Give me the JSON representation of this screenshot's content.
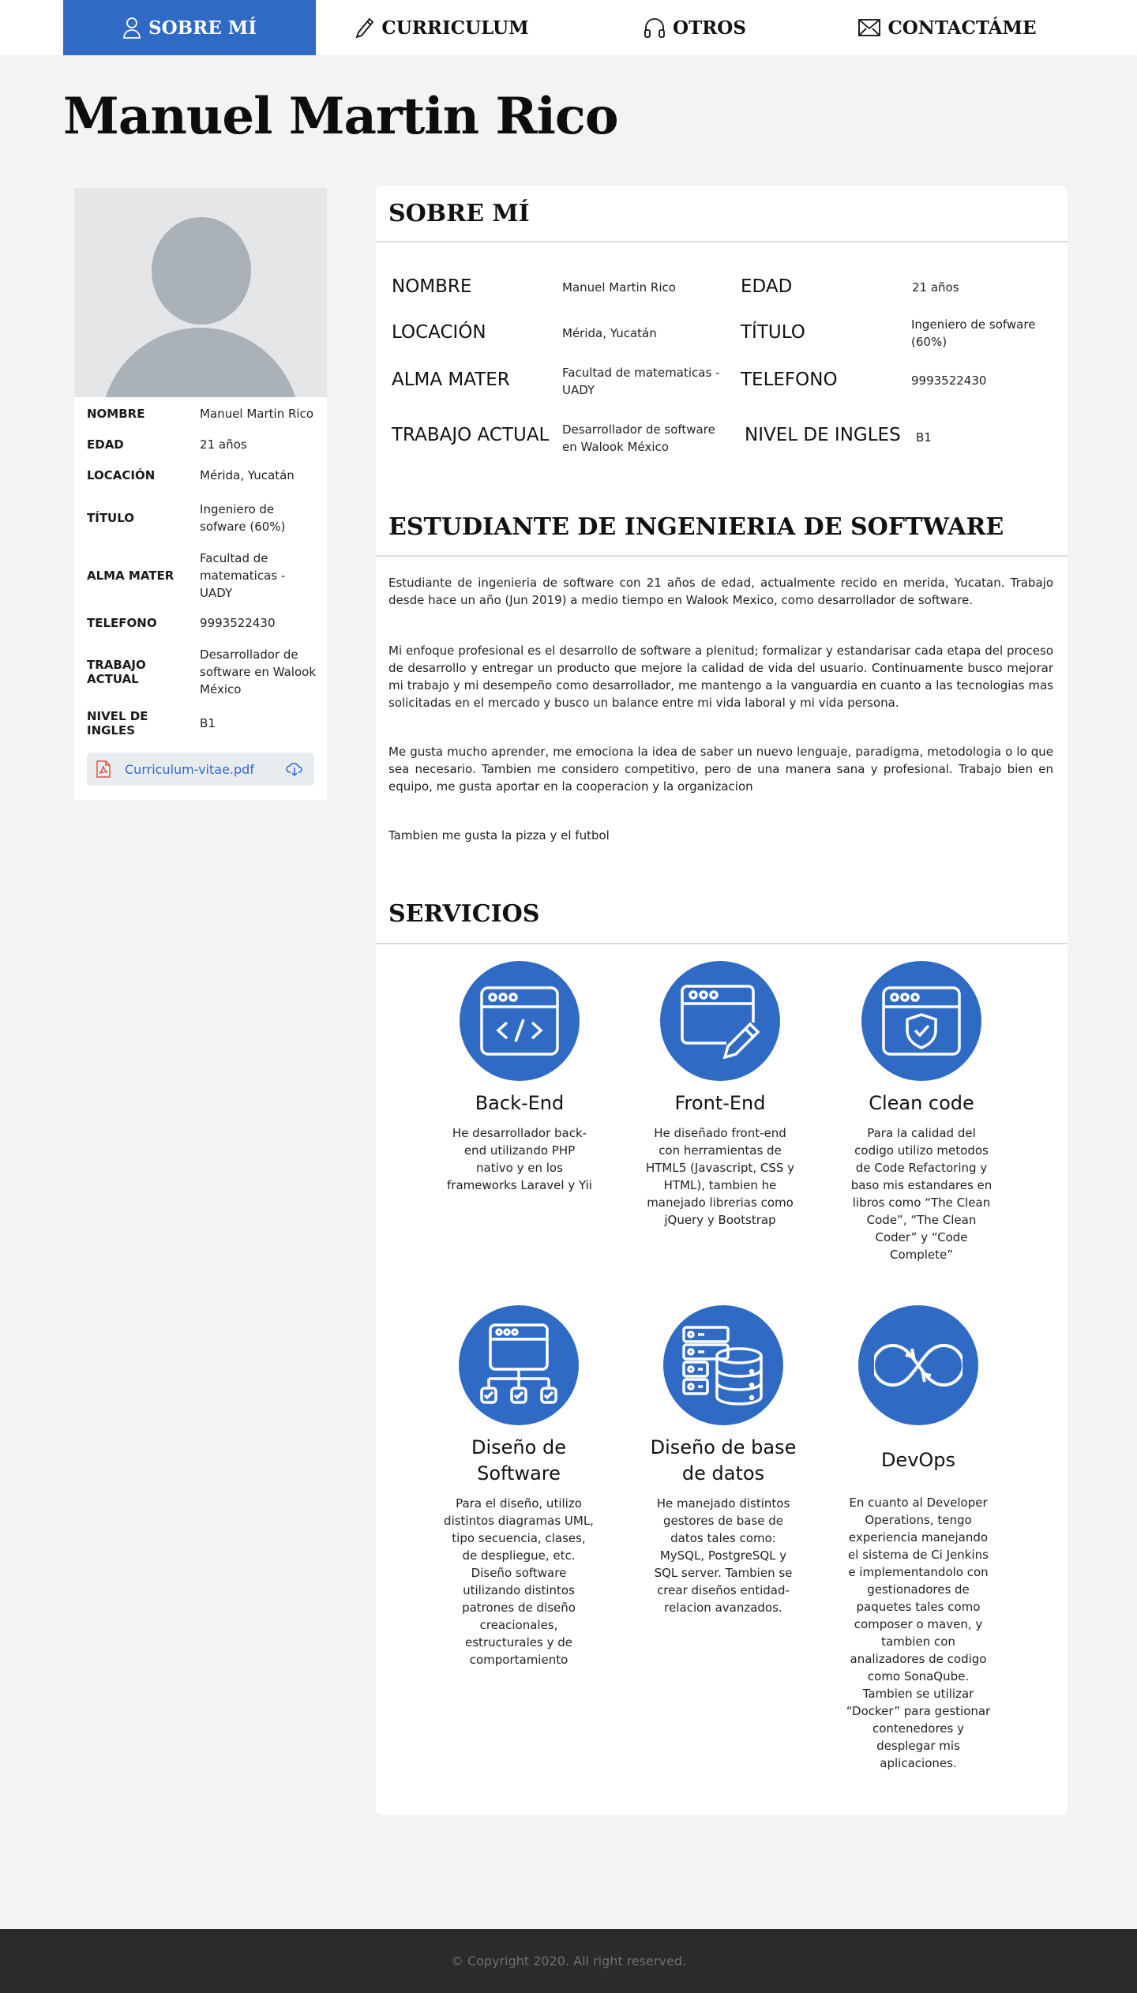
{
  "nav": {
    "items": [
      {
        "label": "SOBRE MÍ",
        "icon": "user-icon",
        "active": true
      },
      {
        "label": "CURRICULUM",
        "icon": "pencil-icon",
        "active": false
      },
      {
        "label": "OTROS",
        "icon": "headphones-icon",
        "active": false
      },
      {
        "label": "CONTACTÁME",
        "icon": "envelope-icon",
        "active": false
      }
    ]
  },
  "page_title": "Manuel Martin Rico",
  "sidebar": {
    "rows": [
      {
        "key": "NOMBRE",
        "value": "Manuel Martin Rico"
      },
      {
        "key": "EDAD",
        "value": "21 años"
      },
      {
        "key": "LOCACIÓN",
        "value": "Mérida, Yucatán"
      },
      {
        "key": "TÍTULO",
        "value": "Ingeniero de sofware (60%)"
      },
      {
        "key": "ALMA MATER",
        "value": "Facultad de matematicas - UADY"
      },
      {
        "key": "TELEFONO",
        "value": "9993522430"
      },
      {
        "key": "TRABAJO ACTUAL",
        "value": "Desarrollador de software en Walook México"
      },
      {
        "key": "NIVEL DE INGLES",
        "value": "B1"
      }
    ],
    "pdf": {
      "label": "Curriculum-vitae.pdf",
      "icon": "pdf-file-icon",
      "download_icon": "cloud-download-icon"
    }
  },
  "about": {
    "title": "SOBRE MÍ",
    "info": [
      {
        "key": "NOMBRE",
        "value": "Manuel Martin Rico"
      },
      {
        "key": "EDAD",
        "value": "21 años"
      },
      {
        "key": "LOCACIÓN",
        "value": "Mérida, Yucatán"
      },
      {
        "key": "TÍTULO",
        "value": "Ingeniero de sofware (60%)"
      },
      {
        "key": "ALMA MATER",
        "value": "Facultad de matematicas - UADY"
      },
      {
        "key": "TELEFONO",
        "value": "9993522430"
      },
      {
        "key": "TRABAJO ACTUAL",
        "value": "Desarrollador de software en Walook México"
      },
      {
        "key": "NIVEL DE INGLES",
        "value": "B1"
      }
    ]
  },
  "student": {
    "title": "ESTUDIANTE DE INGENIERIA DE SOFTWARE",
    "paragraphs": [
      "Estudiante de ingenieria de software con 21 años de edad, actualmente recido en merida, Yucatan. Trabajo desde hace un año (Jun 2019) a medio tiempo en Walook Mexico, como desarrollador de software.",
      "Mi enfoque profesional es el desarrollo de software a plenitud; formalizar y estandarisar cada etapa del proceso de desarrollo y entregar un producto que mejore la calidad de vida del usuario. Continuamente busco mejorar mi trabajo y mi desempeño como desarrollador, me mantengo a la vanguardia en cuanto a las tecnologias mas solicitadas en el mercado y busco un balance entre mi vida laboral y mi vida persona.",
      "Me gusta mucho aprender, me emociona la idea de saber un nuevo lenguaje, paradigma, metodologia o lo que sea necesario. Tambien me considero competitivo, pero de una manera sana y profesional. Trabajo bien en equipo, me gusta aportar en la cooperacion y la organizacion",
      "Tambien me gusta la pizza y el futbol"
    ]
  },
  "services": {
    "title": "SERVICIOS",
    "items": [
      {
        "title": "Back-End",
        "icon": "code-window-icon",
        "desc": "He desarrollador back-end utilizando PHP nativo y en los frameworks Laravel y Yii"
      },
      {
        "title": "Front-End",
        "icon": "design-window-icon",
        "desc": "He diseñado front-end con herramientas de HTML5 (Javascript, CSS y HTML), tambien he manejado librerias como jQuery y Bootstrap"
      },
      {
        "title": "Clean code",
        "icon": "shield-window-icon",
        "desc": "Para la calidad del codigo utilizo metodos de Code Refactoring y baso mis estandares en libros como “The Clean Code”, “The Clean Coder” y “Code Complete”"
      },
      {
        "title": "Diseño de Software",
        "icon": "sitemap-window-icon",
        "desc": "Para el diseño, utilizo distintos diagramas UML, tipo secuencia, clases, de despliegue, etc.  Diseño software utilizando distintos patrones de diseño creacionales, estructurales y de comportamiento"
      },
      {
        "title": "Diseño de base de datos",
        "icon": "database-icon",
        "desc": "He manejado distintos gestores de base de datos tales como: MySQL, PostgreSQL y SQL server. Tambien se crear diseños entidad-relacion avanzados."
      },
      {
        "title": "DevOps",
        "icon": "infinity-loop-icon",
        "desc": "En cuanto al Developer Operations, tengo experiencia manejando el sistema de Ci Jenkins e implementandolo con gestionadores de paquetes tales como composer o maven, y tambien con analizadores de codigo como SonaQube. Tambien se utilizar “Docker” para gestionar contenedores y desplegar mis aplicaciones."
      }
    ]
  },
  "footer": {
    "copyright": "© Copyright 2020. All right reserved."
  },
  "colors": {
    "accent": "#2f6bc5",
    "footer_bg": "#2b2b2b",
    "page_bg": "#f3f3f3"
  }
}
